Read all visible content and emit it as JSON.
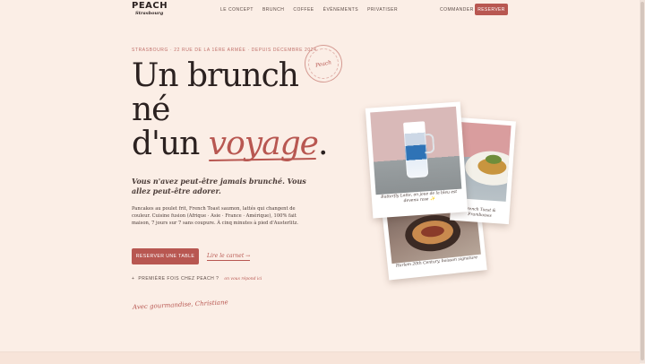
{
  "nav": {
    "brand": "PEACH",
    "city": "Strasbourg",
    "links": [
      "LE CONCEPT",
      "BRUNCH",
      "COFFEE",
      "ÉVÈNEMENTS",
      "PRIVATISER"
    ],
    "order_label": "COMMANDER",
    "reserve_label": "RESERVER"
  },
  "hero": {
    "eyebrow": "STRASBOURG · 22 RUE DE LA 1ÈRE ARMÉE · DEPUIS DÉCEMBRE 2024",
    "title_line1": "Un brunch",
    "title_line2": "né",
    "title_line3_prefix": "d'un ",
    "title_accent": "voyage",
    "title_suffix": ".",
    "stamp": "Peach",
    "subtitle": "Vous n'avez peut-être jamais brunché. Vous allez peut-être adorer.",
    "body": "Pancakes au poulet frit, French Toast saumon, lattés qui changent de couleur. Cuisine fusion (Afrique · Asie · France · Amérique), 100% fait maison, 7 jours sur 7 sans coupure. À cinq minutes à pied d'Austerlitz.",
    "cta_label": "RESERVER UNE TABLE",
    "link_label": "Lire le carnet",
    "link_arrow": "→",
    "first_visit_label": "PREMIÈRE FOIS CHEZ PEACH ?",
    "first_visit_note": "on vous répond ici",
    "signature": "Avec gourmandise, Christiane"
  },
  "polaroids": [
    {
      "caption": "Butterfly Latte, on joue de la bleu est devenu rose ✨"
    },
    {
      "caption": "French Toast & Framboises"
    },
    {
      "caption": "Harlem 20th Century, boisson signature"
    }
  ],
  "colors": {
    "background": "#fbeee6",
    "accent": "#b85751",
    "text": "#2b2120"
  }
}
